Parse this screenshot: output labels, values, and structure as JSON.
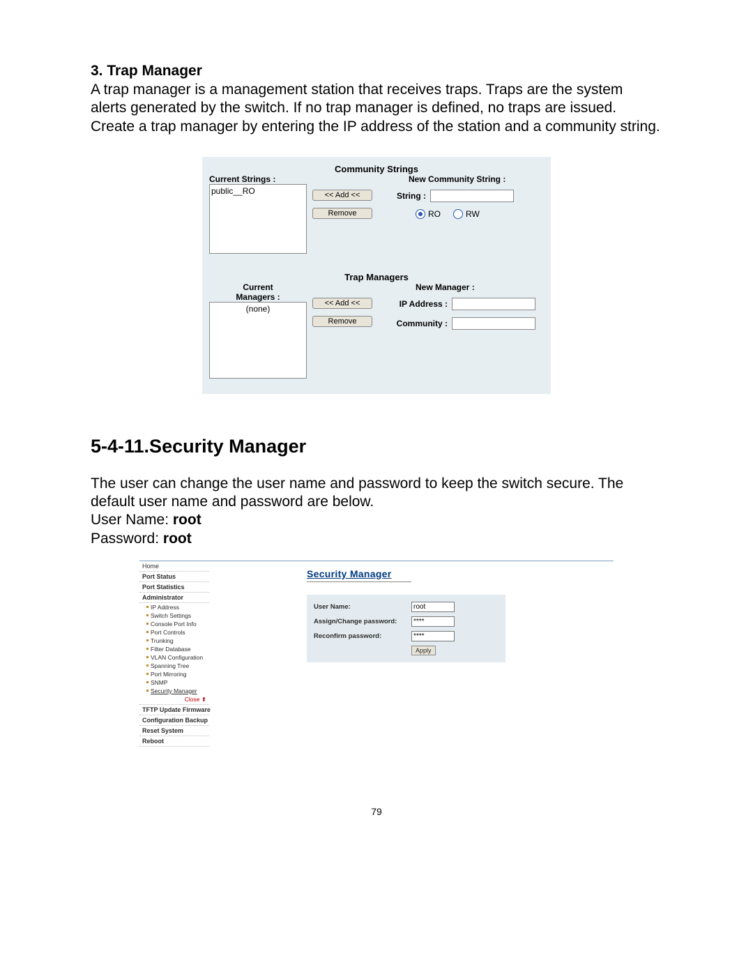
{
  "doc": {
    "trap_heading": "3. Trap Manager",
    "trap_body": "A trap manager is a management station that receives traps.  Traps are the system alerts generated by the switch. If no trap manager is defined, no traps are issued. Create a trap manager by entering the IP address of the station and a community string.",
    "sec_heading": "5-4-11.Security Manager",
    "sec_body": "The user can change the user name and password to keep the switch secure.  The default user name and password are below.",
    "user_name_lbl": "User Name:",
    "user_name_val": "root",
    "password_lbl": "Password:",
    "password_val": "root",
    "page_number": "79"
  },
  "snmp": {
    "community_heading": "Community Strings",
    "current_strings_lbl": "Current Strings :",
    "current_strings_item": "public__RO",
    "add_btn": "<< Add <<",
    "remove_btn": "Remove",
    "new_string_lbl": "New Community String :",
    "string_lbl": "String :",
    "string_val": "",
    "ro_lbl": "RO",
    "rw_lbl": "RW",
    "trap_heading": "Trap Managers",
    "current_mgr_lbl_line1": "Current",
    "current_mgr_lbl_line2": "Managers :",
    "current_mgr_item": "(none)",
    "new_mgr_lbl": "New Manager :",
    "ip_lbl": "IP Address :",
    "ip_val": "",
    "community_lbl": "Community :",
    "community_val": ""
  },
  "secshot": {
    "title": "Security Manager",
    "form": {
      "user_lbl": "User Name:",
      "user_val": "root",
      "pass1_lbl": "Assign/Change password:",
      "pass1_val": "****",
      "pass2_lbl": "Reconfirm password:",
      "pass2_val": "****",
      "apply": "Apply"
    },
    "nav": {
      "home": "Home",
      "port_status": "Port Status",
      "port_stats": "Port Statistics",
      "administrator": "Administrator",
      "ip": "IP Address",
      "switch": "Switch Settings",
      "console": "Console Port Info",
      "portctl": "Port Controls",
      "trunking": "Trunking",
      "filter": "Filter Database",
      "vlan": "VLAN Configuration",
      "spanning": "Spanning Tree",
      "mirror": "Port Mirroring",
      "snmp": "SNMP",
      "security": "Security Manager",
      "close": "Close ⬆",
      "tftp": "TFTP Update Firmware",
      "backup": "Configuration Backup",
      "reset": "Reset System",
      "reboot": "Reboot"
    }
  }
}
